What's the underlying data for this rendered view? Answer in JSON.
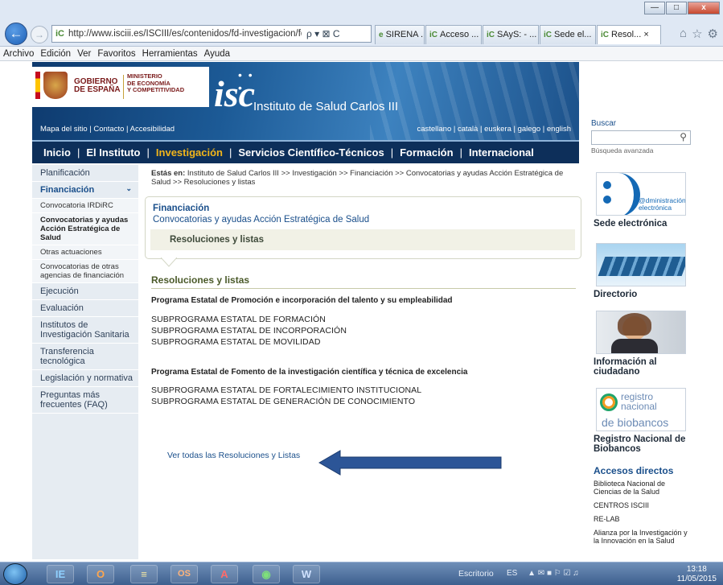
{
  "browser": {
    "url": "http://www.isciii.es/ISCIII/es/contenidos/fd-investigacion/fd-fi",
    "url_controls": "ρ ▾ ⊠ C",
    "tabs": [
      {
        "label": "SIRENA ..."
      },
      {
        "label": "Acceso ..."
      },
      {
        "label": "SAyS: - ..."
      },
      {
        "label": "Sede el..."
      },
      {
        "label": "Resol...",
        "active": true
      }
    ],
    "tab_close": "×",
    "menu": [
      "Archivo",
      "Edición",
      "Ver",
      "Favoritos",
      "Herramientas",
      "Ayuda"
    ],
    "window_controls": {
      "minimize": "—",
      "maximize": "□",
      "close": "x"
    }
  },
  "header": {
    "gobierno": [
      "GOBIERNO",
      "DE ESPAÑA"
    ],
    "ministerio": [
      "MINISTERIO",
      "DE ECONOMÍA",
      "Y COMPETITIVIDAD"
    ],
    "logo": "isc",
    "institute": "Instituto de Salud Carlos III",
    "util_left": "Mapa del sitio | Contacto | Accesibilidad",
    "languages": "castellano | català | euskera | galego | english",
    "nav": [
      {
        "label": "Inicio"
      },
      {
        "label": "El Instituto"
      },
      {
        "label": "Investigación",
        "current": true
      },
      {
        "label": "Servicios Científico-Técnicos"
      },
      {
        "label": "Formación"
      },
      {
        "label": "Internacional"
      }
    ],
    "nav_separator": "|"
  },
  "search": {
    "label": "Buscar",
    "advanced": "Búsqueda avanzada",
    "icon": "search-icon"
  },
  "sidebar": {
    "items": [
      {
        "label": "Planificación",
        "type": "item"
      },
      {
        "label": "Financiación",
        "type": "head",
        "chevron": "⌄"
      },
      {
        "label": "Convocatoria IRDiRC",
        "type": "sub"
      },
      {
        "label": "Convocatorias y ayudas Acción Estratégica de Salud",
        "type": "sub",
        "selected": true
      },
      {
        "label": "Otras actuaciones",
        "type": "sub"
      },
      {
        "label": "Convocatorias de otras agencias de financiación",
        "type": "sub"
      },
      {
        "label": "Ejecución",
        "type": "item"
      },
      {
        "label": "Evaluación",
        "type": "item"
      },
      {
        "label": "Institutos de Investigación Sanitaria",
        "type": "item"
      },
      {
        "label": "Transferencia tecnológica",
        "type": "item"
      },
      {
        "label": "Legislación y normativa",
        "type": "item"
      },
      {
        "label": "Preguntas más frecuentes (FAQ)",
        "type": "item"
      }
    ]
  },
  "breadcrumb": {
    "prefix": "Estás en:",
    "path": "Instituto de Salud Carlos III >> Investigación >> Financiación >> Convocatorias y ayudas Acción Estratégica de Salud >> Resoluciones y listas"
  },
  "infobox": {
    "title": "Financiación",
    "subtitle": "Convocatorias y ayudas Acción Estratégica de Salud",
    "section": "Resoluciones y listas"
  },
  "main": {
    "heading": "Resoluciones y listas",
    "programs": [
      {
        "title": "Programa Estatal de Promoción e incorporación del talento y su empleabilidad",
        "subprograms": [
          "SUBPROGRAMA ESTATAL DE FORMACIÓN",
          "SUBPROGRAMA ESTATAL DE INCORPORACIÓN",
          "SUBPROGRAMA ESTATAL DE MOVILIDAD"
        ]
      },
      {
        "title": "Programa Estatal de Fomento de la investigación científica y técnica de excelencia",
        "subprograms": [
          "SUBPROGRAMA ESTATAL DE FORTALECIMIENTO INSTITUCIONAL",
          "SUBPROGRAMA ESTATAL DE GENERACIÓN DE CONOCIMIENTO"
        ]
      }
    ],
    "see_all": "Ver todas las Resoluciones y Listas"
  },
  "rightcol": {
    "sede": "Sede electrónica",
    "admin_logo": "@dministración electrónica",
    "directorio": "Directorio",
    "info": "Información al ciudadano",
    "biobancos_logo": [
      "registro",
      "nacional",
      "de biobancos"
    ],
    "biobancos": "Registro Nacional de Biobancos",
    "accesos_title": "Accesos directos",
    "accesos": [
      "Biblioteca Nacional de Ciencias de la Salud",
      "CENTROS ISCIII",
      "RE-LAB",
      "Alianza por la Investigación y la Innovación en la Salud"
    ]
  },
  "taskbar": {
    "apps": [
      "IE",
      "O",
      "≡",
      "OS",
      "A",
      "◉",
      "W"
    ],
    "escritorio": "Escritorio",
    "lang": "ES",
    "time": "13:18",
    "date": "11/05/2015"
  },
  "colors": {
    "nav_bg": "#0d2f5a",
    "nav_current": "#f2b51a",
    "link": "#1a4f8b",
    "heading": "#4b5a2a",
    "arrow": "#2c5597"
  }
}
